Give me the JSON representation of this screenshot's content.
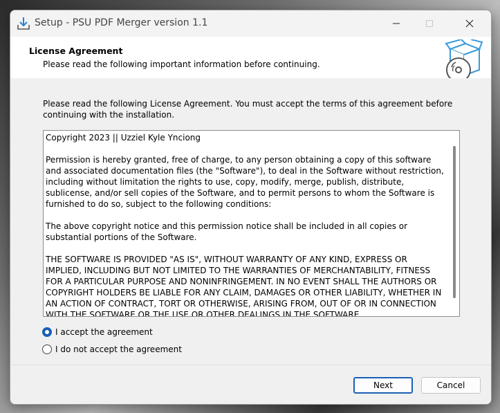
{
  "window": {
    "title": "Setup - PSU PDF Merger version 1.1"
  },
  "titlebar": {
    "minimize_icon": "minimize-icon",
    "maximize_icon": "maximize-icon",
    "close_icon": "close-icon"
  },
  "header": {
    "title": "License Agreement",
    "subtitle": "Please read the following important information before continuing.",
    "icon": "setup-box-disc-icon"
  },
  "main": {
    "intro": "Please read the following License Agreement. You must accept the terms of this agreement before continuing with the installation.",
    "license_text": "Copyright 2023 || Uzziel Kyle Ynciong\n\nPermission is hereby granted, free of charge, to any person obtaining a copy of this software and associated documentation files (the \"Software\"), to deal in the Software without restriction, including without limitation the rights to use, copy, modify, merge, publish, distribute, sublicense, and/or sell copies of the Software, and to permit persons to whom the Software is furnished to do so, subject to the following conditions:\n\nThe above copyright notice and this permission notice shall be included in all copies or substantial portions of the Software.\n\nTHE SOFTWARE IS PROVIDED \"AS IS\", WITHOUT WARRANTY OF ANY KIND, EXPRESS OR IMPLIED, INCLUDING BUT NOT LIMITED TO THE WARRANTIES OF MERCHANTABILITY, FITNESS FOR A PARTICULAR PURPOSE AND NONINFRINGEMENT. IN NO EVENT SHALL THE AUTHORS OR COPYRIGHT HOLDERS BE LIABLE FOR ANY CLAIM, DAMAGES OR OTHER LIABILITY, WHETHER IN AN ACTION OF CONTRACT, TORT OR OTHERWISE, ARISING FROM, OUT OF OR IN CONNECTION WITH THE SOFTWARE OR THE USE OR OTHER DEALINGS IN THE SOFTWARE.",
    "options": [
      {
        "label": "I accept the agreement",
        "selected": true
      },
      {
        "label": "I do not accept the agreement",
        "selected": false
      }
    ]
  },
  "footer": {
    "next_label": "Next",
    "cancel_label": "Cancel"
  },
  "colors": {
    "accent": "#1a5fb4",
    "icon_blue": "#3a9ad9"
  }
}
